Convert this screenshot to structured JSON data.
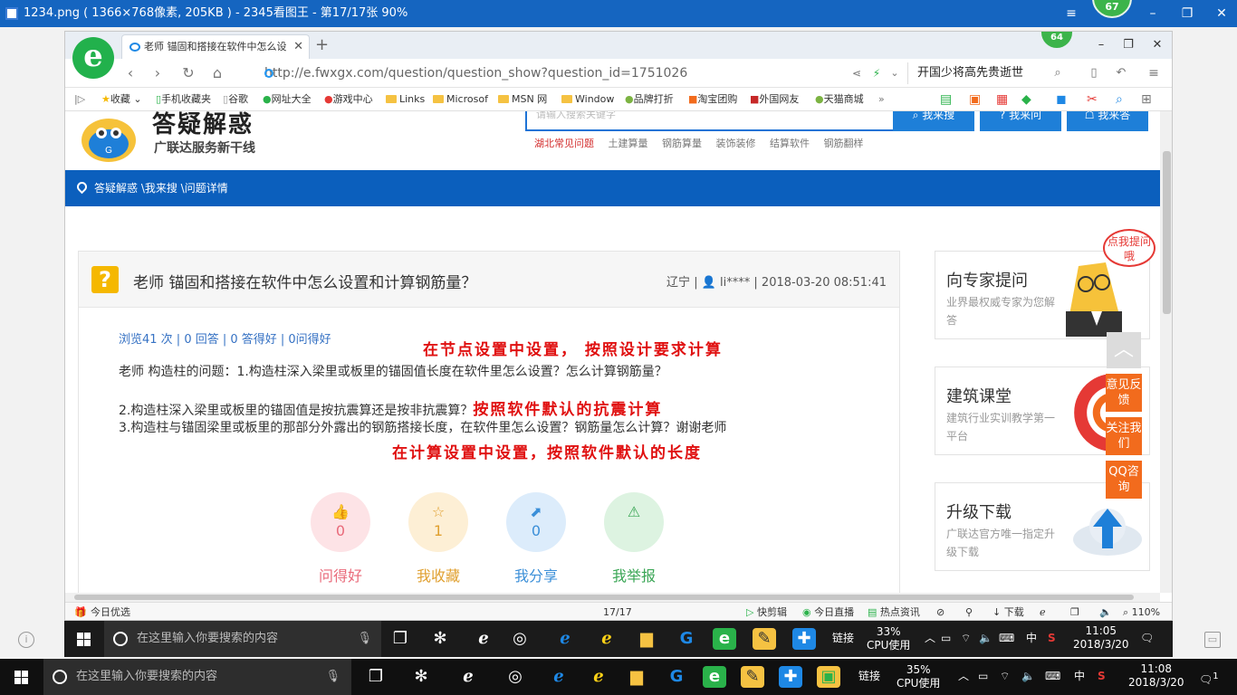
{
  "viewer": {
    "title": "1234.png ( 1366×768像素, 205KB ) - 2345看图王 - 第17/17张 90%",
    "badge": "67",
    "page_counter": "17/17"
  },
  "browser": {
    "tab_title": "老师 锚固和搭接在软件中怎么设",
    "badge": "64",
    "url": "http://e.fwxgx.com/question/question_show?question_id=1751026",
    "search_text": "开国少将高先贵逝世",
    "bookmarks": [
      "收藏",
      "手机收藏夹",
      "谷歌",
      "网址大全",
      "游戏中心",
      "Links",
      "Microsof",
      "MSN 网",
      "Window",
      "品牌打折",
      "淘宝团购",
      "外国网友",
      "天猫商城"
    ],
    "status_left": "今日优选",
    "status_items": [
      "快剪辑",
      "今日直播",
      "热点资讯",
      "下载",
      "110%"
    ]
  },
  "site": {
    "brand_title": "答疑解惑",
    "brand_sub": "广联达服务新干线",
    "search_placeholder": "请输入搜索关键字",
    "search_buttons": [
      "我来搜",
      "我来问",
      "我来答"
    ],
    "categories": [
      "湖北常见问题",
      "土建算量",
      "钢筋算量",
      "装饰装修",
      "结算软件",
      "钢筋翻样"
    ],
    "breadcrumb": "答疑解惑 \\我来搜 \\问题详情"
  },
  "question": {
    "title": "老师 锚固和搭接在软件中怎么设置和计算钢筋量？",
    "meta_location": "辽宁",
    "meta_user": "li****",
    "meta_time": "2018-03-20 08:51:41",
    "stats": "浏览41 次 | 0 回答 | 0 答得好 | 0问得好",
    "line1": "老师  构造柱的问题：1.构造柱深入梁里或板里的锚固值长度在软件里怎么设置？怎么计算钢筋量？",
    "line2": "2.构造柱深入梁里或板里的锚固值是按抗震算还是按非抗震算？",
    "line3": "3.构造柱与锚固梁里或板里的那部分外露出的钢筋搭接长度，在软件里怎么设置？钢筋量怎么计算？谢谢老师",
    "annotations": [
      "在节点设置中设置， 按照设计要求计算",
      "按照软件默认的抗震计算",
      "在计算设置中设置，按照软件默认的长度"
    ],
    "actions": [
      {
        "count": "0",
        "label": "问得好",
        "color": "#e96a7a",
        "bg": "#fde3e6"
      },
      {
        "count": "1",
        "label": "我收藏",
        "color": "#e0a030",
        "bg": "#fdefd5"
      },
      {
        "count": "0",
        "label": "我分享",
        "color": "#3b8fd8",
        "bg": "#dcecfb"
      },
      {
        "count": "0",
        "label": "我举报",
        "color": "#3aa655",
        "bg": "#ddf3e1"
      }
    ]
  },
  "sidebar": {
    "bubble": "点我提问哦",
    "boxes": [
      {
        "title": "向专家提问",
        "desc": "业界最权威专家为您解答"
      },
      {
        "title": "建筑课堂",
        "desc": "建筑行业实训教学第一平台"
      },
      {
        "title": "升级下载",
        "desc": "广联达官方唯一指定升级下载"
      }
    ],
    "float_buttons": [
      "意见反馈",
      "关注我们",
      "QQ咨询"
    ]
  },
  "taskbar_inner": {
    "search_placeholder": "在这里输入你要搜索的内容",
    "link_label": "链接",
    "cpu_percent": "33%",
    "cpu_label": "CPU使用",
    "ime": "中",
    "time": "11:05",
    "date": "2018/3/20"
  },
  "taskbar": {
    "search_placeholder": "在这里输入你要搜索的内容",
    "link_label": "链接",
    "cpu_percent": "35%",
    "cpu_label": "CPU使用",
    "ime": "中",
    "time": "11:08",
    "date": "2018/3/20",
    "notification_count": "1"
  }
}
